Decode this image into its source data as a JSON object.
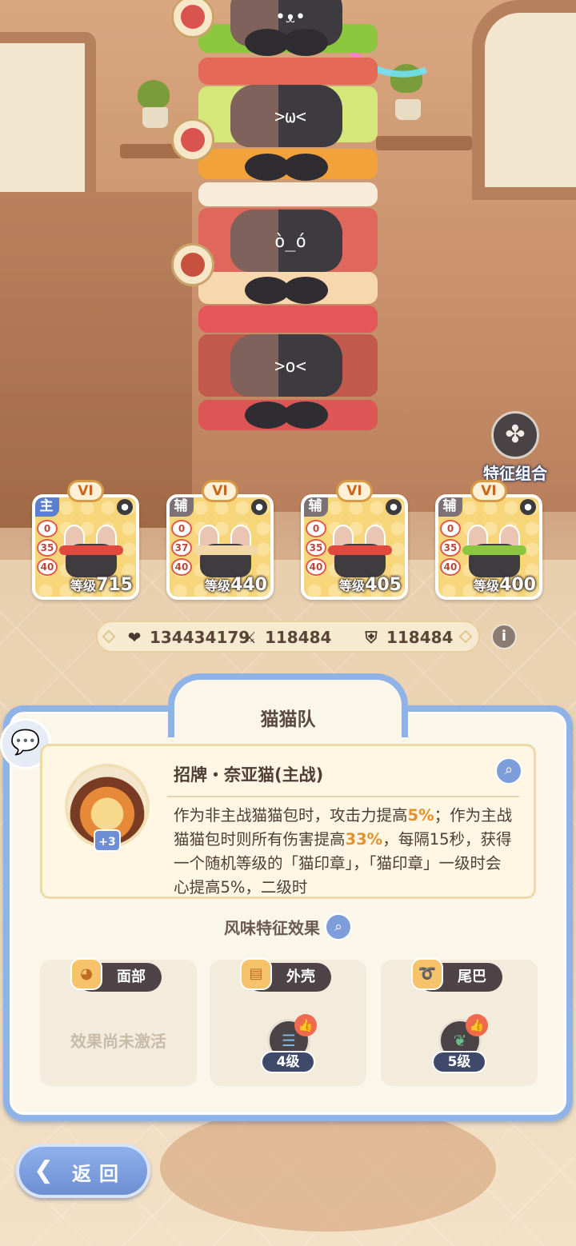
{
  "trait_combo": {
    "label": "特征组合",
    "icon": "clover-icon"
  },
  "team": [
    {
      "rank": "VI",
      "role": "主",
      "role_color": "#5b7fcf",
      "stats": [
        "0",
        "35",
        "40"
      ],
      "level_label": "等级",
      "level": "715",
      "band_color": "#e2493e"
    },
    {
      "rank": "VI",
      "role": "辅",
      "role_color": "#7c7275",
      "stats": [
        "0",
        "37",
        "40"
      ],
      "level_label": "等级",
      "level": "440",
      "band_color": "#f3d7a6"
    },
    {
      "rank": "VI",
      "role": "辅",
      "role_color": "#7c7275",
      "stats": [
        "0",
        "35",
        "40"
      ],
      "level_label": "等级",
      "level": "405",
      "band_color": "#e2493e"
    },
    {
      "rank": "VI",
      "role": "辅",
      "role_color": "#7c7275",
      "stats": [
        "0",
        "35",
        "40"
      ],
      "level_label": "等级",
      "level": "400",
      "band_color": "#8cc63f"
    }
  ],
  "stats": {
    "hp": "134434179",
    "attack": "118484",
    "defense": "118484"
  },
  "panel": {
    "title": "猫猫队",
    "skill": {
      "name": "招牌・奈亚猫(主战)",
      "badge": "+3",
      "desc_parts": [
        "作为非主战猫猫包时，攻击力提高",
        "5%",
        "；作为主战猫猫包时则所有伤害提高",
        "33%",
        "，每隔15秒，获得一个随机等级的「猫印章」，「猫印章」一级时会心提高5%，二级时"
      ]
    },
    "flavor_title": "风味特征效果",
    "traits": [
      {
        "tag": "面部",
        "empty_text": "效果尚未激活"
      },
      {
        "tag": "外壳",
        "level": "4级"
      },
      {
        "tag": "尾巴",
        "level": "5级"
      }
    ]
  },
  "back_label": "返回"
}
